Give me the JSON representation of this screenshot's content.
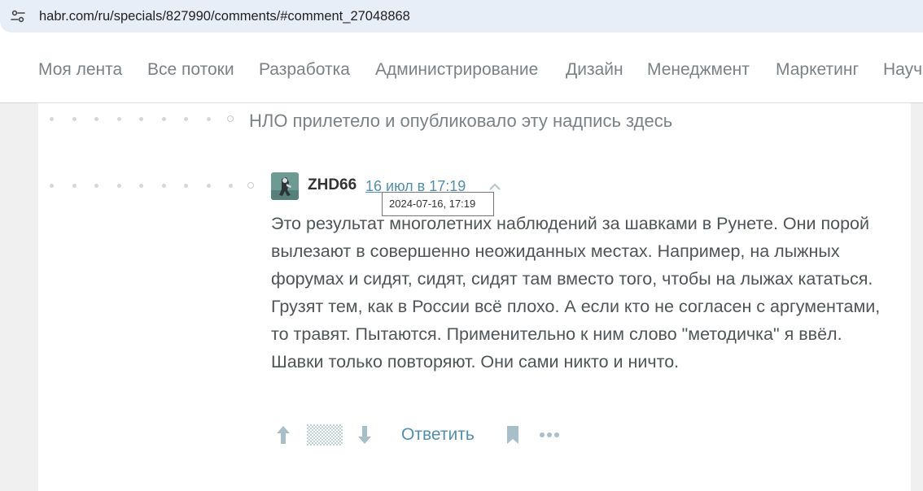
{
  "browser": {
    "url": "habr.com/ru/specials/827990/comments/#comment_27048868",
    "site_settings_icon": "tune-icon"
  },
  "nav": {
    "items": [
      {
        "label": "Моя лента"
      },
      {
        "label": "Все потоки"
      },
      {
        "label": "Разработка"
      },
      {
        "label": "Администрирование"
      },
      {
        "label": "Дизайн"
      },
      {
        "label": "Менеджмент"
      },
      {
        "label": "Маркетинг"
      },
      {
        "label": "Научпоп"
      }
    ]
  },
  "ufo_comment": {
    "text": "НЛО прилетело и опубликовало эту надпись здесь"
  },
  "comment": {
    "username": "ZHD66",
    "date": "16 июл в 17:19",
    "date_tooltip": "2024-07-16, 17:19",
    "body": "Это результат многолетних наблюдений за шавками в Рунете. Они порой вылезают в совершенно неожиданных местах. Например, на лыжных форумах и сидят, сидят, сидят там вместо того, чтобы на лыжах кататься. Грузят тем, как в России всё плохо. А если кто не согласен с аргументами, то травят. Пытаются. Применительно к ним слово \"методичка\" я ввёл. Шавки только повторяют. Они сами никто и ничто.",
    "actions": {
      "reply_label": "Ответить",
      "upvote_icon": "arrow-up-icon",
      "downvote_icon": "arrow-down-icon",
      "bookmark_icon": "bookmark-icon",
      "more_icon": "more-dots-icon"
    }
  },
  "colors": {
    "link": "#548eaa",
    "text": "#505457",
    "nav_text": "#7b8287",
    "page_bg": "#f0f0f0"
  }
}
